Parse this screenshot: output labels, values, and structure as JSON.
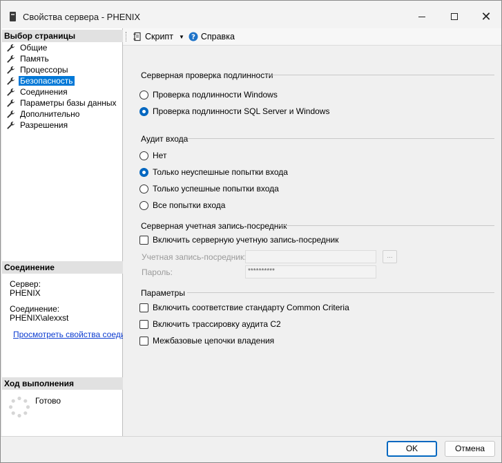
{
  "window": {
    "title": "Свойства сервера - PHENIX"
  },
  "left": {
    "pages_header": "Выбор страницы",
    "pages": [
      {
        "label": "Общие",
        "selected": false
      },
      {
        "label": "Память",
        "selected": false
      },
      {
        "label": "Процессоры",
        "selected": false
      },
      {
        "label": "Безопасность",
        "selected": true
      },
      {
        "label": "Соединения",
        "selected": false
      },
      {
        "label": "Параметры базы данных",
        "selected": false
      },
      {
        "label": "Дополнительно",
        "selected": false
      },
      {
        "label": "Разрешения",
        "selected": false
      }
    ],
    "connection_header": "Соединение",
    "server_label": "Сервер:",
    "server_value": "PHENIX",
    "conn_label": "Соединение:",
    "conn_value": "PHENIX\\alexxst",
    "view_props_link": "Просмотреть свойства соединения",
    "progress_header": "Ход выполнения",
    "progress_status": "Готово"
  },
  "toolbar": {
    "script_label": "Скрипт",
    "help_label": "Справка"
  },
  "auth": {
    "title": "Серверная проверка подлинности",
    "options": [
      "Проверка подлинности Windows",
      "Проверка подлинности SQL Server и Windows"
    ],
    "selected_index": 1
  },
  "audit": {
    "title": "Аудит входа",
    "options": [
      "Нет",
      "Только неуспешные попытки входа",
      "Только успешные попытки входа",
      "Все попытки входа"
    ],
    "selected_index": 1
  },
  "proxy": {
    "title": "Серверная учетная запись-посредник",
    "enable_label": "Включить серверную учетную запись-посредник",
    "account_label": "Учетная запись-посредник:",
    "account_value": "",
    "browse_label": "...",
    "password_label": "Пароль:",
    "password_value": "**********"
  },
  "params": {
    "title": "Параметры",
    "options": [
      "Включить соответствие стандарту Common Criteria",
      "Включить трассировку аудита C2",
      "Межбазовые цепочки владения"
    ]
  },
  "buttons": {
    "ok": "OK",
    "cancel": "Отмена"
  }
}
